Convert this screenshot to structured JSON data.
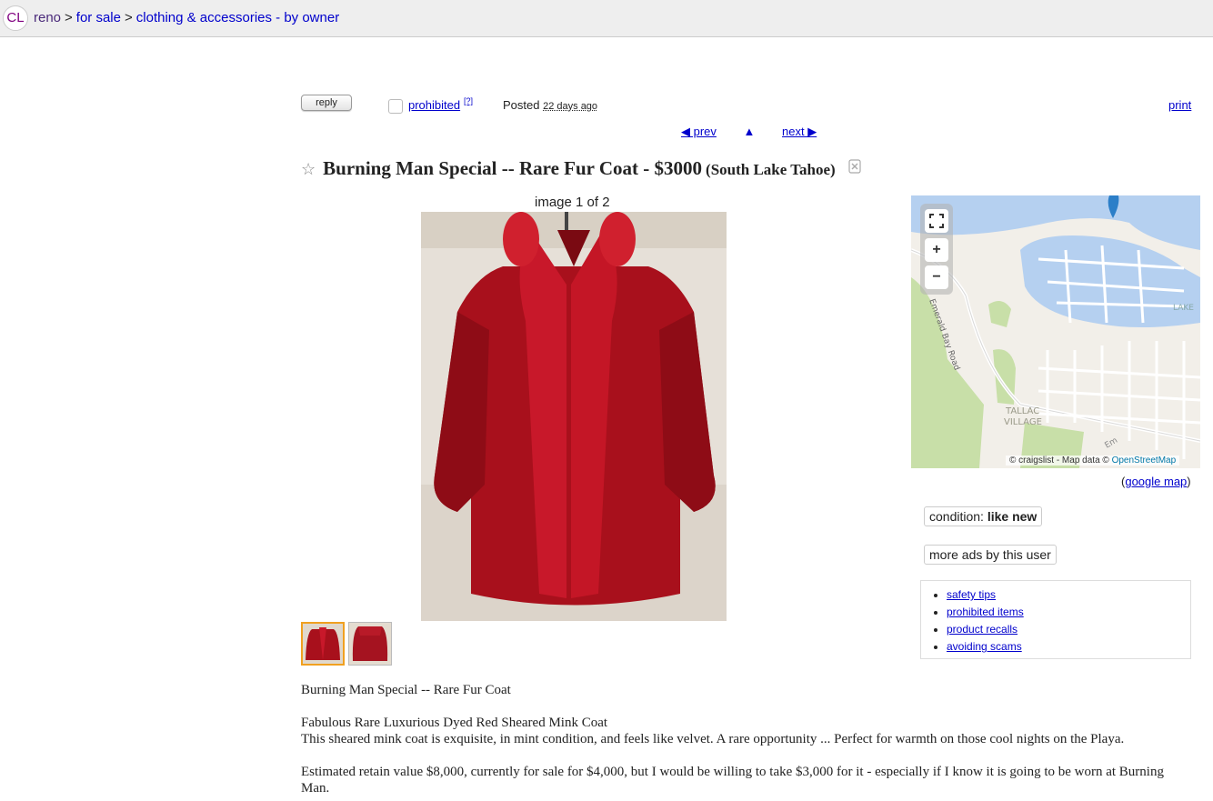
{
  "header": {
    "logo": "CL",
    "area": "reno",
    "sep": ">",
    "crumb_section": "for sale",
    "crumb_category": "clothing & accessories - by owner"
  },
  "actions": {
    "reply": "reply",
    "flag_label": "prohibited",
    "flag_help": "[?]",
    "posted_label": "Posted",
    "posted_ago": "22 days ago",
    "print": "print"
  },
  "nav": {
    "prev": "◀ prev",
    "up": "▲",
    "next": "next ▶"
  },
  "post": {
    "star": "☆",
    "title": "Burning Man Special -- Rare Fur Coat - $3000",
    "location": "(South Lake Tahoe)"
  },
  "gallery": {
    "caption": "image 1 of 2",
    "coat_color": "#b01020"
  },
  "map": {
    "label_lake": "LAKE",
    "label_road": "Emerald Bay Road",
    "label_village_1": "TALLAC",
    "label_village_2": "VILLAGE",
    "label_em": "Em",
    "attribution": "© craigslist - Map data ©",
    "osm": "OpenStreetMap",
    "zoom_in": "+",
    "zoom_out": "−",
    "google_open": "(",
    "google_map": "google map",
    "google_close": ")"
  },
  "attributes": {
    "condition_label": "condition:",
    "condition_value": "like new",
    "more_ads": "more ads by this user"
  },
  "safety": {
    "items": [
      "safety tips",
      "prohibited items",
      "product recalls",
      "avoiding scams"
    ]
  },
  "body": {
    "line1": "Burning Man Special -- Rare Fur Coat",
    "line2": "Fabulous Rare Luxurious Dyed Red Sheared Mink Coat",
    "line3": "This sheared mink coat is exquisite, in mint condition, and feels like velvet. A rare opportunity ... Perfect for warmth on those cool nights on the Playa.",
    "line4": "Estimated retain value $8,000, currently for sale for $4,000, but I would be willing to take $3,000 for it - especially if I know it is going to be worn at Burning Man."
  }
}
